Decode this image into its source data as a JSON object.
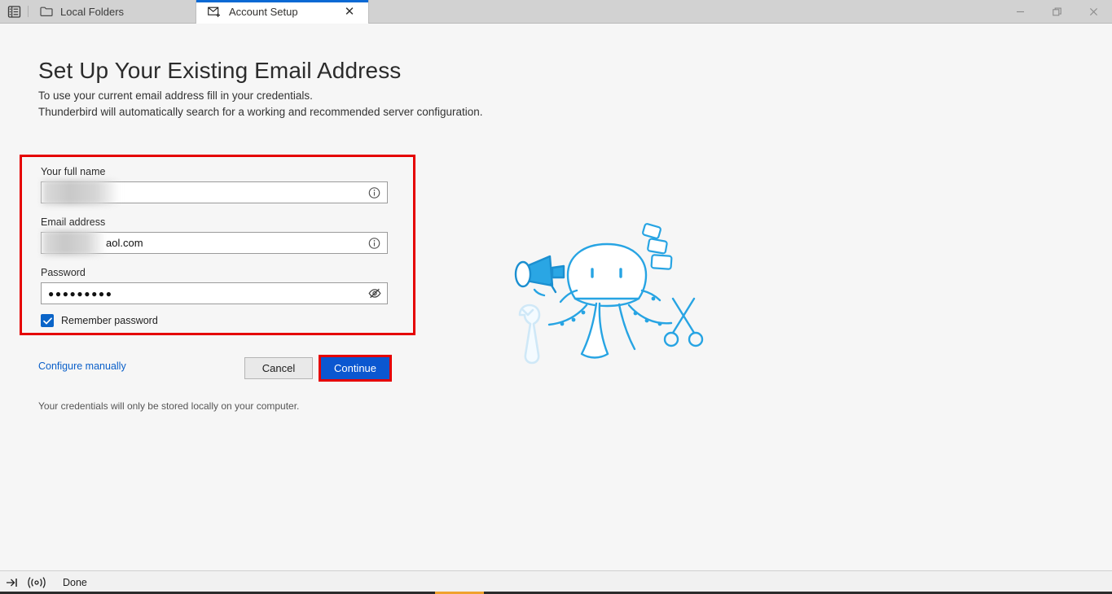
{
  "window": {
    "controls": [
      {
        "name": "minimize-button",
        "glyph": "—"
      },
      {
        "name": "restore-button",
        "glyph": "❐"
      },
      {
        "name": "close-window-button",
        "glyph": "✕"
      }
    ]
  },
  "tabbar": {
    "spaces_toggle_icon": "spaces-toggle-icon",
    "tabs": [
      {
        "label": "Local Folders",
        "icon": "folder-icon",
        "active": false
      },
      {
        "label": "Account Setup",
        "icon": "new-mail-account-icon",
        "active": true,
        "close_glyph": "✕"
      }
    ]
  },
  "main": {
    "title": "Set Up Your Existing Email Address",
    "description_line1": "To use your current email address fill in your credentials.",
    "description_line2": "Thunderbird will automatically search for a working and recommended server configuration.",
    "form": {
      "highlighted": true,
      "highlight_color": "#e50000",
      "fields": [
        {
          "label": "Your full name",
          "value": "",
          "redacted": true,
          "redacted_width": 95,
          "icon": "info-icon"
        },
        {
          "label": "Email address",
          "value": "aol.com",
          "redacted": true,
          "redacted_width": 78,
          "icon": "info-icon"
        },
        {
          "label": "Password",
          "value": "●●●●●●●●●",
          "redacted": false,
          "icon": "hide-password-icon"
        }
      ],
      "remember_password": {
        "label": "Remember password",
        "checked": true,
        "color": "#0a64c8"
      }
    },
    "actions": {
      "configure_manually_label": "Configure manually",
      "configure_manually_color": "#0a5fc9",
      "cancel_label": "Cancel",
      "continue_label": "Continue",
      "continue_color": "#0b57d0",
      "continue_highlighted": true
    },
    "footnote": "Your credentials will only be stored locally on your computer.",
    "illustration": {
      "name": "thunderbird-octopus-illustration",
      "accent_color": "#21a1e1"
    }
  },
  "statusbar": {
    "expand_icon": "expand-panel-icon",
    "activity_icon": "network-activity-icon",
    "status_text": "Done"
  }
}
